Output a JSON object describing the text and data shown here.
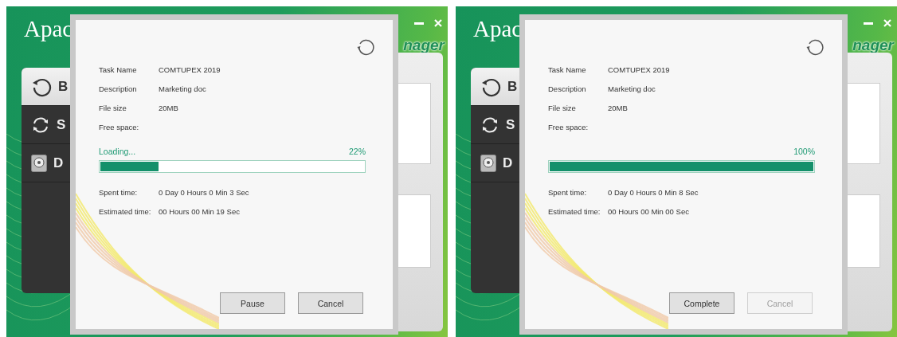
{
  "panels": [
    {
      "app": {
        "logo": "Apac",
        "title_fragment": "nager",
        "sidebar": [
          {
            "label": "B",
            "selected": true,
            "kind": "backup"
          },
          {
            "label": "S",
            "selected": false,
            "kind": "sync"
          },
          {
            "label": "D",
            "selected": false,
            "kind": "disk"
          }
        ]
      },
      "dialog": {
        "fields": [
          {
            "label": "Task Name",
            "value": "COMTUPEX 2019"
          },
          {
            "label": "Description",
            "value": "Marketing doc"
          },
          {
            "label": "File size",
            "value": "20MB"
          },
          {
            "label": "Free space:"
          }
        ],
        "status": "Loading...",
        "percent": "22%",
        "level": 0.22,
        "times": [
          {
            "label": "Spent time:",
            "value": "0 Day 0 Hours 0 Min 3 Sec"
          },
          {
            "label": "Estimated time:",
            "value": "00 Hours 00 Min 19 Sec"
          }
        ],
        "buttons": [
          {
            "label": "Pause",
            "disabled": false
          },
          {
            "label": "Cancel",
            "disabled": false
          }
        ]
      }
    },
    {
      "app": {
        "logo": "Apac",
        "title_fragment": "nager",
        "sidebar": [
          {
            "label": "B",
            "selected": true,
            "kind": "backup"
          },
          {
            "label": "S",
            "selected": false,
            "kind": "sync"
          },
          {
            "label": "D",
            "selected": false,
            "kind": "disk"
          }
        ]
      },
      "dialog": {
        "fields": [
          {
            "label": "Task Name",
            "value": "COMTUPEX 2019"
          },
          {
            "label": "Description",
            "value": "Marketing doc"
          },
          {
            "label": "File size",
            "value": "20MB"
          },
          {
            "label": "Free space:"
          }
        ],
        "percent": "100%",
        "level": 1,
        "times": [
          {
            "label": "Spent time:",
            "value": "0 Day 0 Hours 0 Min 8 Sec"
          },
          {
            "label": "Estimated time:",
            "value": "00 Hours 00 Min 00 Sec"
          }
        ],
        "buttons": [
          {
            "label": "Complete",
            "disabled": false
          },
          {
            "label": "Cancel",
            "disabled": true
          }
        ]
      }
    }
  ]
}
